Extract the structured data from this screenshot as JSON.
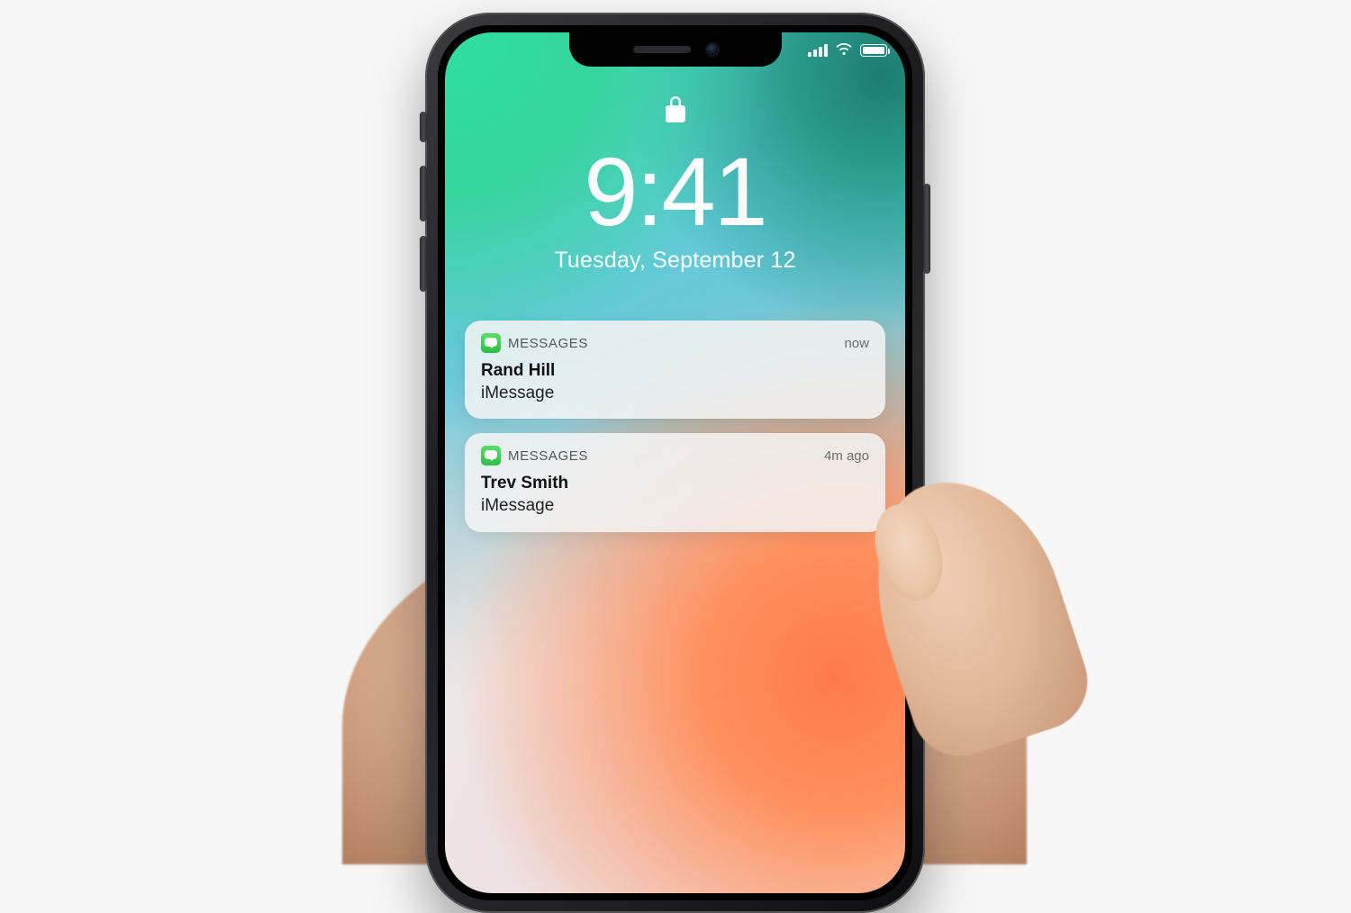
{
  "lockscreen": {
    "time": "9:41",
    "date": "Tuesday, September 12"
  },
  "status": {
    "signal_icon": "cellular-signal-icon",
    "wifi_icon": "wifi-icon",
    "battery_icon": "battery-full-icon"
  },
  "notifications": [
    {
      "app_name": "MESSAGES",
      "app_icon": "messages-app-icon",
      "sender": "Rand Hill",
      "subtext": "iMessage",
      "time": "now"
    },
    {
      "app_name": "MESSAGES",
      "app_icon": "messages-app-icon",
      "sender": "Trev Smith",
      "subtext": "iMessage",
      "time": "4m ago"
    }
  ],
  "icons": {
    "lock": "lock-icon"
  },
  "colors": {
    "messages_app": "#34c759",
    "card_bg": "rgba(245,245,245,0.86)"
  }
}
